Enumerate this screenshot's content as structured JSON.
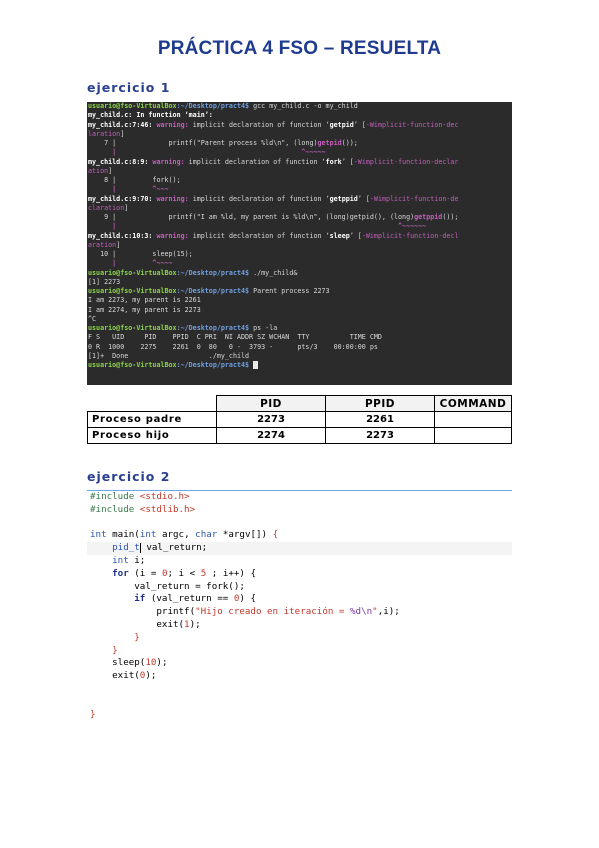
{
  "page_title": "PRÁCTICA 4 FSO – RESUELTA",
  "sections": {
    "s1": "ejercicio 1",
    "s2": "ejercicio 2"
  },
  "terminal": {
    "prompt_user": "usuario@fso-VirtualBox",
    "prompt_path": ":~/Desktop/pract4$",
    "lines": {
      "l1_cmd": " gcc my_child.c -o my_child",
      "l2": "my_child.c: In function ‘main’:",
      "l3_loc": "my_child.c:7:46: ",
      "l3_warn": "warning: ",
      "l3_msg": "implicit declaration of function ‘",
      "l3_fn": "getpid",
      "l3_end": "’ [",
      "l3_opt": "-Wimplicit-function-dec",
      "l4_opt": "laration",
      "l4_end": "]",
      "l5": "    7 |             printf(\"Parent process %ld\\n\", (long)",
      "l5_hl": "getpid",
      "l5_end": "());",
      "l6": "      |                                              ^~~~~~",
      "l7_loc": "my_child.c:8:9: ",
      "l7_warn": "warning: ",
      "l7_msg": "implicit declaration of function ‘",
      "l7_fn": "fork",
      "l7_end": "’ [",
      "l7_opt": "-Wimplicit-function-declar",
      "l8_opt": "ation",
      "l8_end": "]",
      "l9": "    8 |         fork();",
      "l10": "      |         ^~~~",
      "l11_loc": "my_child.c:9:70: ",
      "l11_warn": "warning: ",
      "l11_msg": "implicit declaration of function ‘",
      "l11_fn": "getppid",
      "l11_end": "’ [",
      "l11_opt": "-Wimplicit-function-de",
      "l12_opt": "claration",
      "l12_end": "]",
      "l13": "    9 |             printf(\"I am %ld, my parent is %ld\\n\", (long)getpid(), (long)",
      "l13_hl": "getppid",
      "l13_end": "());",
      "l14": "      |                                                                      ^~~~~~~",
      "l15_loc": "my_child.c:10:3: ",
      "l15_warn": "warning: ",
      "l15_msg": "implicit declaration of function ‘",
      "l15_fn": "sleep",
      "l15_end": "’ [",
      "l15_opt": "-Wimplicit-function-decl",
      "l16_opt": "aration",
      "l16_end": "]",
      "l17": "   10 |         sleep(15);",
      "l18": "      |         ^~~~~",
      "l19_cmd": " ./my_child&",
      "l20": "[1] 2273",
      "l21_cmd": " Parent process 2273",
      "l22": "I am 2273, my parent is 2261",
      "l23": "I am 2274, my parent is 2273",
      "l24": "^C",
      "l25_cmd": " ps -la",
      "l26": "F S   UID     PID    PPID  C PRI  NI ADDR SZ WCHAN  TTY          TIME CMD",
      "l27": "0 R  1000    2275    2261  0  80   0 -  3793 -      pts/3    00:00:00 ps",
      "l28": "[1]+  Done                    ./my_child"
    }
  },
  "pid_table": {
    "headers": [
      "",
      "PID",
      "PPID",
      "COMMAND"
    ],
    "rows": [
      {
        "label": "Proceso padre",
        "pid": "2273",
        "ppid": "2261",
        "command": ""
      },
      {
        "label": "Proceso hijo",
        "pid": "2274",
        "ppid": "2273",
        "command": ""
      }
    ]
  },
  "code": {
    "inc1_kw": "#include",
    "inc1_hdr": " <stdio.h>",
    "inc2_kw": "#include",
    "inc2_hdr": " <stdlib.h>",
    "main_type": "int",
    "main_name": " main(",
    "main_arg1t": "int",
    "main_arg1": " argc, ",
    "main_arg2t": "char",
    "main_arg2": " *argv[]) ",
    "main_brace": "{",
    "l_pid_type": "    pid_t",
    "l_pid_var": " val_return;",
    "l_int_type": "    int",
    "l_int_var": " i;",
    "l_for_kw": "    for",
    "l_for_a": " (i = ",
    "l_for_n0": "0",
    "l_for_b": "; i < ",
    "l_for_n5": "5",
    "l_for_c": " ; i++) {",
    "l_fork": "        val_return = fork();",
    "l_if_kw": "        if",
    "l_if_a": " (val_return == ",
    "l_if_n0": "0",
    "l_if_b": ") {",
    "l_printf_a": "            printf(",
    "l_printf_str": "\"Hijo creado en iteración = ",
    "l_printf_ph": "%d\\n",
    "l_printf_q": "\"",
    "l_printf_b": ",i);",
    "l_exit_a": "            exit(",
    "l_exit_n": "1",
    "l_exit_b": ");",
    "l_close1": "        }",
    "l_close2": "    }",
    "l_sleep_a": "    sleep(",
    "l_sleep_n": "10",
    "l_sleep_b": ");",
    "l_exit2_a": "    exit(",
    "l_exit2_n": "0",
    "l_exit2_b": ");",
    "l_final": "}"
  }
}
